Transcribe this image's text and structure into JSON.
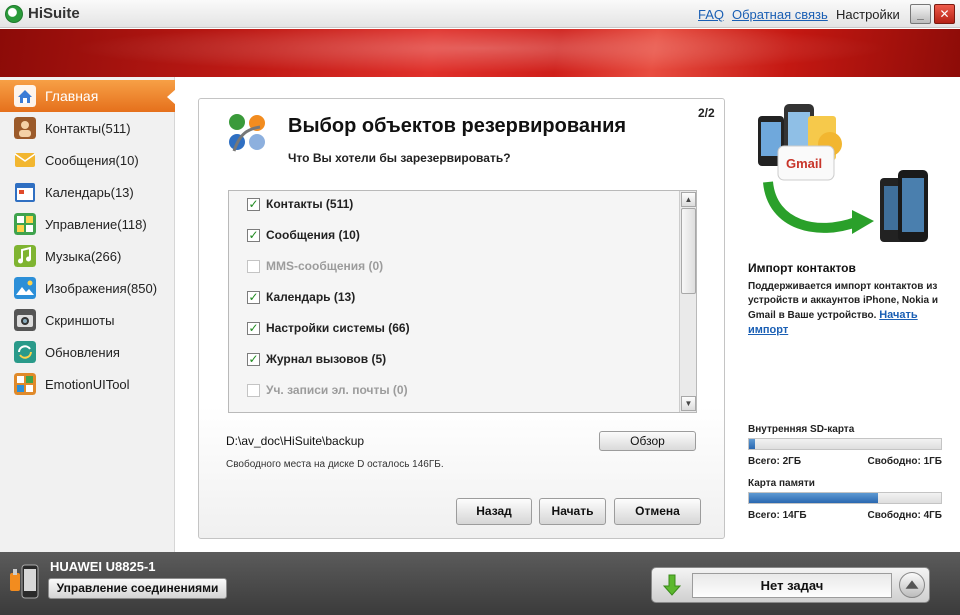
{
  "app": {
    "title": "HiSuite"
  },
  "header": {
    "faq_label": "FAQ",
    "feedback_label": "Обратная связь",
    "settings_label": "Настройки"
  },
  "window": {
    "minimize": "_",
    "close": "✕"
  },
  "sidebar": {
    "items": [
      {
        "label": "Главная",
        "icon": "home-icon",
        "color": "#3a7bd5"
      },
      {
        "label": "Контакты(511)",
        "icon": "contacts-icon",
        "color": "#9b5a2a"
      },
      {
        "label": "Сообщения(10)",
        "icon": "messages-icon",
        "color": "#f2b630"
      },
      {
        "label": "Календарь(13)",
        "icon": "calendar-icon",
        "color": "#2f6fc2"
      },
      {
        "label": "Управление(118)",
        "icon": "apps-icon",
        "color": "#3fa34d"
      },
      {
        "label": "Музыка(266)",
        "icon": "music-icon",
        "color": "#7fb431"
      },
      {
        "label": "Изображения(850)",
        "icon": "pictures-icon",
        "color": "#2c8fd8"
      },
      {
        "label": "Скриншоты",
        "icon": "screenshot-icon",
        "color": "#555555"
      },
      {
        "label": "Обновления",
        "icon": "update-icon",
        "color": "#2a9a8a"
      },
      {
        "label": "EmotionUITool",
        "icon": "emotionui-icon",
        "color": "#e08a2a"
      }
    ]
  },
  "dialog": {
    "page": "2/2",
    "title": "Выбор объектов резервирования",
    "subtitle": "Что Вы хотели бы зарезервировать?",
    "items": [
      {
        "label": "Контакты (511)",
        "checked": true,
        "enabled": true
      },
      {
        "label": "Сообщения (10)",
        "checked": true,
        "enabled": true
      },
      {
        "label": "MMS-сообщения (0)",
        "checked": false,
        "enabled": false
      },
      {
        "label": "Календарь (13)",
        "checked": true,
        "enabled": true
      },
      {
        "label": "Настройки системы (66)",
        "checked": true,
        "enabled": true
      },
      {
        "label": "Журнал вызовов (5)",
        "checked": true,
        "enabled": true
      },
      {
        "label": "Уч. записи эл. почты (0)",
        "checked": false,
        "enabled": false
      }
    ],
    "path": "D:\\av_doc\\HiSuite\\backup",
    "browse_label": "Обзор",
    "free_space": "Свободного места на диске D осталось 146ГБ.",
    "back_label": "Назад",
    "start_label": "Начать",
    "cancel_label": "Отмена"
  },
  "promo": {
    "title": "Импорт контактов",
    "text": "Поддерживается импорт контактов из устройств и аккаунтов iPhone, Nokia и Gmail в Ваше устройство.",
    "link": "Начать импорт",
    "gmail_text": "Gmail"
  },
  "storage": {
    "internal": {
      "label": "Внутренняя SD-карта",
      "total": "Всего: 2ГБ",
      "free": "Свободно: 1ГБ",
      "used_fraction": 0.03
    },
    "card": {
      "label": "Карта памяти",
      "total": "Всего: 14ГБ",
      "free": "Свободно: 4ГБ",
      "used_fraction": 0.67
    }
  },
  "device": {
    "name": "HUAWEI U8825-1",
    "connection_label": "Управление соединениями"
  },
  "tasks": {
    "status": "Нет задач"
  },
  "colors": {
    "accent": "#e5701c",
    "banner": "#c21b16",
    "link": "#1a5fb4",
    "check": "#1f8a1f",
    "storage_fill": "#2a68b0"
  }
}
